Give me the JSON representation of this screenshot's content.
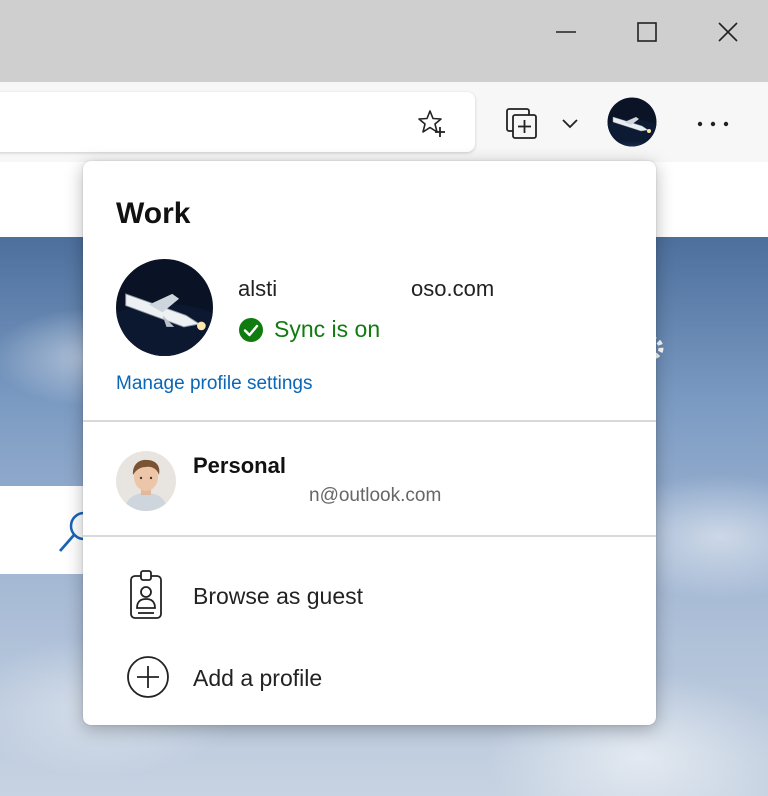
{
  "window_controls": {
    "minimize_icon": "minimize-icon",
    "maximize_icon": "maximize-icon",
    "close_icon": "close-icon"
  },
  "toolbar": {
    "favorite_icon": "add-favorite-star-icon",
    "collections_icon": "collections-icon",
    "chevron_icon": "chevron-down-icon",
    "profile_icon": "profile-avatar",
    "more_icon": "more-horizontal-icon"
  },
  "flyout": {
    "title": "Work",
    "work_account": {
      "email_visible_start": "alsti",
      "email_visible_end": "oso.com",
      "sync_status": "Sync is on",
      "sync_color": "#107c10"
    },
    "manage_link": "Manage profile settings",
    "link_color": "#0a66b7",
    "personal": {
      "name": "Personal",
      "email": "n@outlook.com"
    },
    "menu": {
      "browse_guest": "Browse as guest",
      "add_profile": "Add a profile"
    }
  }
}
